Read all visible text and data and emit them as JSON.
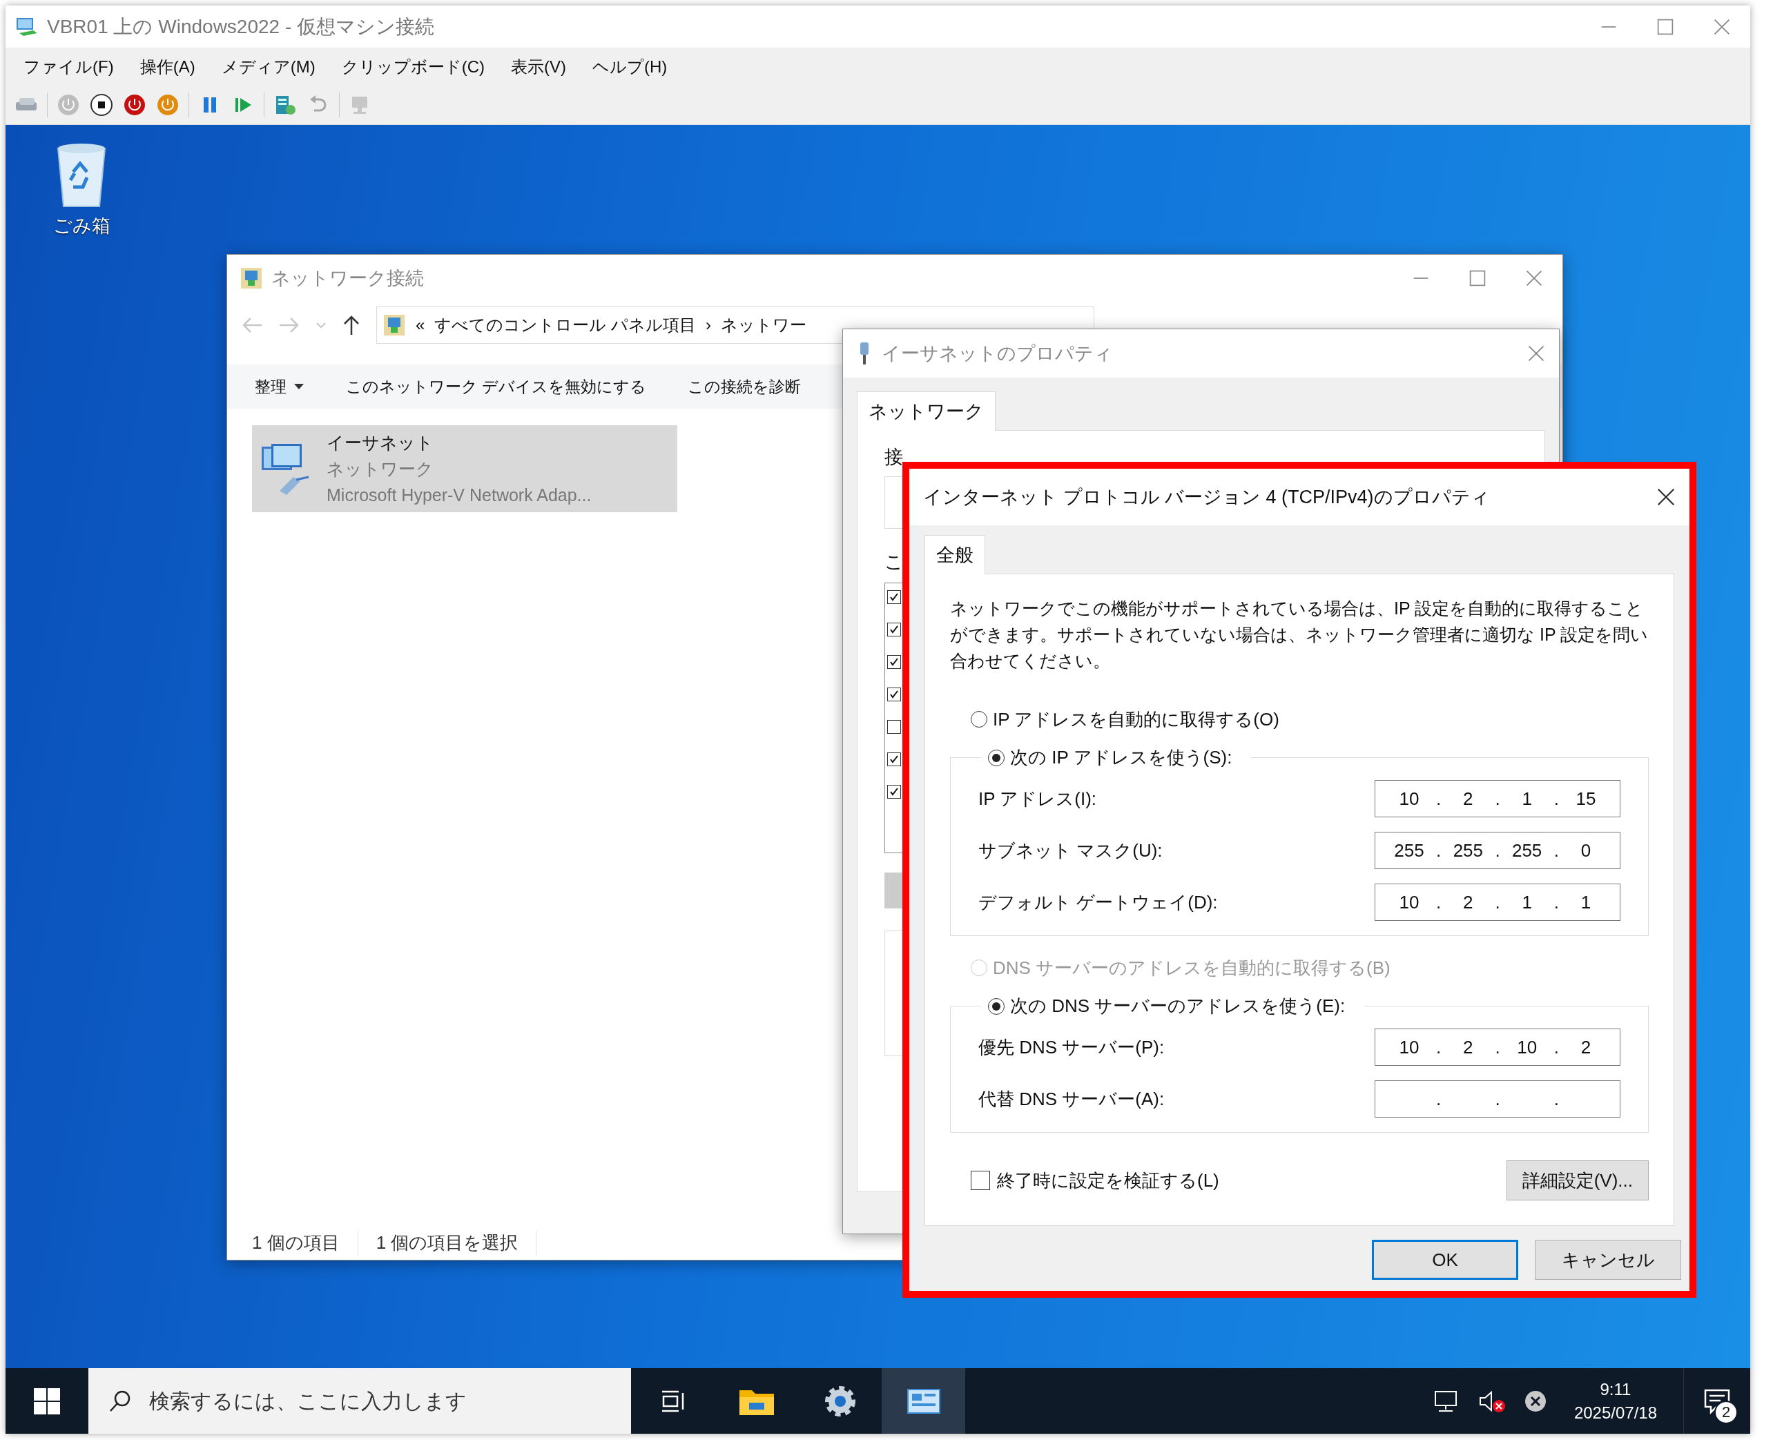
{
  "vm_window": {
    "title": "VBR01 上の Windows2022  - 仮想マシン接続"
  },
  "menu": [
    "ファイル(F)",
    "操作(A)",
    "メディア(M)",
    "クリップボード(C)",
    "表示(V)",
    "ヘルプ(H)"
  ],
  "toolbar": [
    {
      "kind": "keys",
      "disabled": false
    },
    {
      "kind": "start",
      "disabled": true
    },
    {
      "kind": "stop",
      "disabled": false
    },
    {
      "kind": "turnoff",
      "disabled": false
    },
    {
      "kind": "shutdown",
      "disabled": false
    },
    {
      "kind": "pause",
      "disabled": false
    },
    {
      "kind": "resume",
      "disabled": false
    },
    {
      "kind": "checkpoint",
      "disabled": false
    },
    {
      "kind": "revert",
      "disabled": true
    },
    {
      "kind": "session",
      "disabled": true
    }
  ],
  "desktop_icons": [
    {
      "label": "ごみ箱"
    }
  ],
  "network_window": {
    "title": "ネットワーク接続",
    "address": {
      "prefix": "«",
      "path": [
        "すべてのコントロール パネル項目",
        "ネットワー"
      ],
      "separator": "›"
    },
    "commands": [
      {
        "label": "整理",
        "dropdown": true
      },
      {
        "label": "このネットワーク デバイスを無効にする",
        "dropdown": false
      },
      {
        "label": "この接続を診断",
        "dropdown": false
      }
    ],
    "items": [
      {
        "name": "イーサネット",
        "network": "ネットワーク",
        "adapter": "Microsoft Hyper-V Network Adap...",
        "selected": true
      }
    ],
    "status": [
      "1 個の項目",
      "1 個の項目を選択"
    ]
  },
  "ethernet_window": {
    "title": "イーサネットのプロパティ",
    "tabs": [
      {
        "label": "ネットワーク",
        "selected": true
      }
    ],
    "connect_label": "接",
    "components_label": "こ",
    "components": [
      {
        "checked": true
      },
      {
        "checked": true
      },
      {
        "checked": true
      },
      {
        "checked": true
      },
      {
        "checked": false
      },
      {
        "checked": true
      },
      {
        "checked": true
      }
    ]
  },
  "ipv4_dialog": {
    "title": "インターネット プロトコル バージョン 4 (TCP/IPv4)のプロパティ",
    "tabs": [
      {
        "label": "全般",
        "selected": true
      }
    ],
    "description": "ネットワークでこの機能がサポートされている場合は、IP 設定を自動的に取得することができます。サポートされていない場合は、ネットワーク管理者に適切な IP 設定を問い合わせてください。",
    "ip_options": [
      {
        "label": "IP アドレスを自動的に取得する(O)",
        "selected": false,
        "disabled": false
      },
      {
        "label": "次の IP アドレスを使う(S):",
        "selected": true,
        "disabled": false
      }
    ],
    "ip_fields": [
      {
        "label": "IP アドレス(I):",
        "value": "10 . 2 . 1 . 15"
      },
      {
        "label": "サブネット マスク(U):",
        "value": "255 . 255 . 255 . 0"
      },
      {
        "label": "デフォルト ゲートウェイ(D):",
        "value": "10 . 2 . 1 . 1"
      }
    ],
    "dns_options": [
      {
        "label": "DNS サーバーのアドレスを自動的に取得する(B)",
        "selected": false,
        "disabled": true
      },
      {
        "label": "次の DNS サーバーのアドレスを使う(E):",
        "selected": true,
        "disabled": false
      }
    ],
    "dns_fields": [
      {
        "label": "優先 DNS サーバー(P):",
        "value": "10 . 2 . 10 . 2"
      },
      {
        "label": "代替 DNS サーバー(A):",
        "value": ". . ."
      }
    ],
    "validate": {
      "label": "終了時に設定を検証する(L)",
      "checked": false
    },
    "advanced_button": "詳細設定(V)...",
    "buttons": [
      {
        "label": "OK",
        "default": true
      },
      {
        "label": "キャンセル",
        "default": false
      }
    ]
  },
  "taskbar": {
    "search_placeholder": "検索するには、ここに入力します",
    "apps": [
      {
        "kind": "task_view",
        "active": false
      },
      {
        "kind": "explorer",
        "active": false
      },
      {
        "kind": "settings",
        "active": false
      },
      {
        "kind": "control_panel",
        "active": true
      }
    ],
    "time": "9:11",
    "date": "2025/07/18",
    "notifications": "2"
  }
}
